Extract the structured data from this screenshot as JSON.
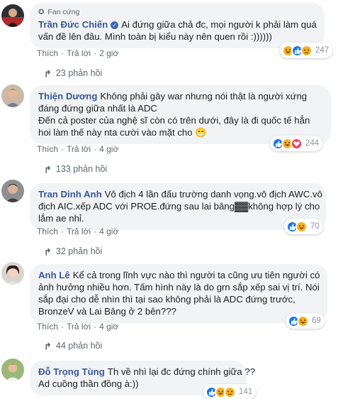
{
  "comments": [
    {
      "badge": "Fan cứng",
      "author": "Trần Đức Chiến",
      "verified": true,
      "lines": [
        "Ai đứng giữa chả đc, mọi người k phải làm quá",
        "vấn đề lên đâu. Mình toàn bị kiểu này nên quen rồi :))))))"
      ],
      "actions": {
        "like": "Thích",
        "reply": "Trả lời",
        "time": "2 giờ"
      },
      "reactions": {
        "icons": [
          "haha",
          "like",
          "sad"
        ],
        "count": "247"
      },
      "replies": "23 phản hồi"
    },
    {
      "author": "Thiện Dương",
      "lines": [
        "Không phải gây war nhưng nói thật là người xứng",
        "đáng đứng giữa nhất là ADC",
        "Đến cả poster của nghệ sĩ còn có trên dưới, đây là đi quốc tế hẳn",
        "hoi làm thế này nta cười vào mặt cho 😁"
      ],
      "actions": {
        "like": "Thích",
        "reply": "Trả lời",
        "time": "4 giờ"
      },
      "reactions": {
        "icons": [
          "like",
          "haha",
          "love"
        ],
        "count": "244"
      },
      "replies": "133 phản hồi"
    },
    {
      "author": "Tran Dinh Anh",
      "lines": [
        "Vô địch 4 lần đấu trường danh vọng.vô địch AWC.vô",
        "địch AIC.xếp ADC với PROE.đứng sau lai bâng▓▓không hợp lý cho",
        "lắm ae nhỉ."
      ],
      "actions": {
        "like": "Thích",
        "reply": "Trả lời",
        "time": "4 giờ"
      },
      "reactions": {
        "icons": [
          "like",
          "haha"
        ],
        "count": "70"
      },
      "replies": "32 phản hồi"
    },
    {
      "author": "Anh Lê",
      "lines": [
        "Kể cả trong lĩnh vực nào thì người ta cũng ưu tiên người có",
        "ảnh hưởng nhiều hơn. Tấm hình này là do grn sắp xếp sai vị trí. Nói",
        "sắp đại cho dễ nhìn thì tại sao không phải là ADC đứng trước,",
        "BronzeV và Lai Bâng ở 2 bên???"
      ],
      "actions": {
        "like": "Thích",
        "reply": "Trả lời",
        "time": "4 giờ"
      },
      "reactions": {
        "icons": [
          "like",
          "haha"
        ],
        "count": "69"
      },
      "replies": "44 phản hồi"
    },
    {
      "author": "Đỗ Trọng Tùng",
      "lines": [
        "Th về nhì lại đc đứng chính giữa ??",
        "Ad cuồng thần đồng à:))"
      ],
      "actions": {
        "like": "Thích",
        "reply": "Trả lời",
        "time": "4 giờ"
      },
      "reactions": {
        "icons": [
          "like",
          "haha",
          "sad"
        ],
        "count": "141"
      }
    }
  ],
  "colors": {
    "author": "#385898",
    "bubble": "#f2f3f5",
    "meta": "#606770",
    "like": "#1877f2",
    "haha": "#f7b125",
    "love": "#f33e58"
  }
}
